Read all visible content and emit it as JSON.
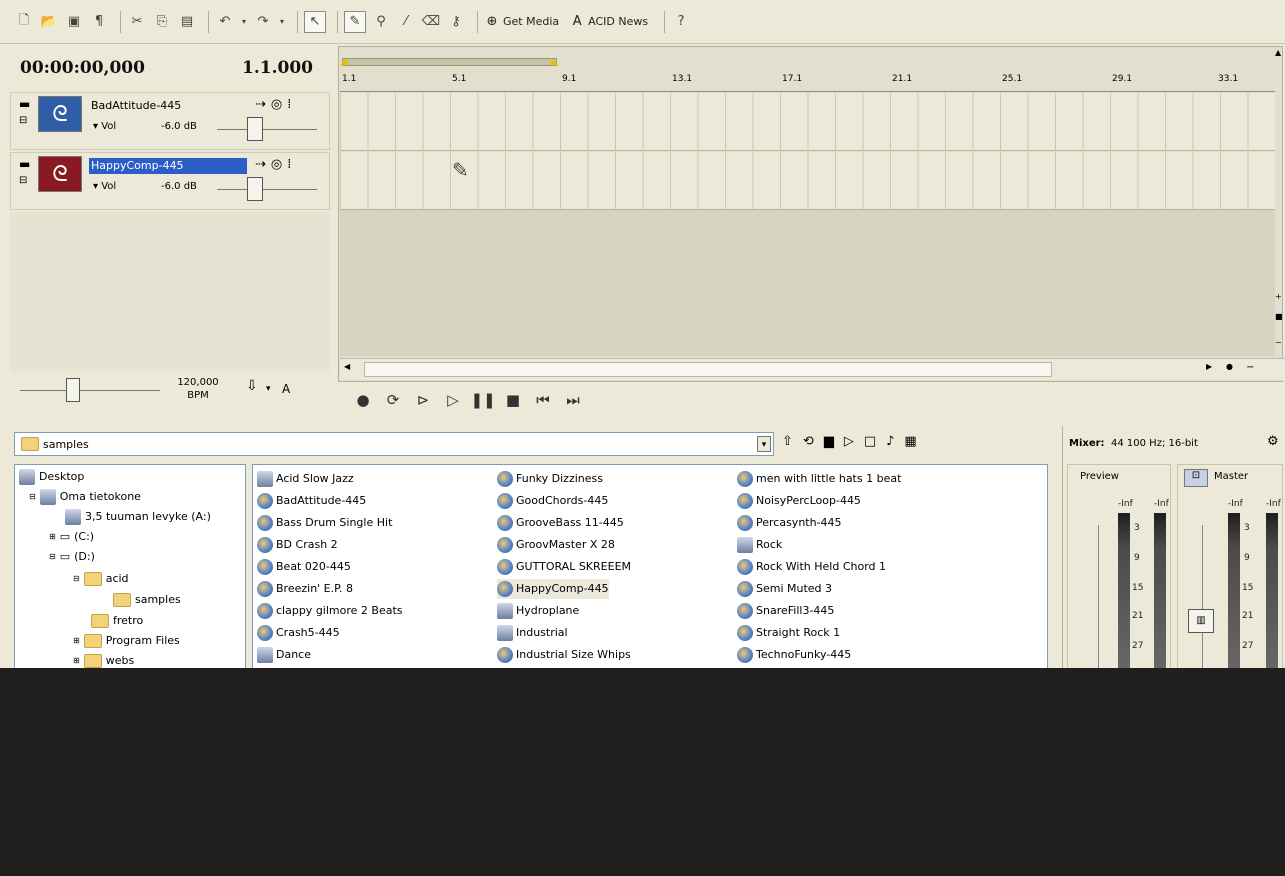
{
  "toolbar": {
    "buttons": [
      {
        "name": "new-icon",
        "glyph": "🗋"
      },
      {
        "name": "open-icon",
        "glyph": "📂"
      },
      {
        "name": "save-icon",
        "glyph": "💾"
      },
      {
        "name": "properties-icon",
        "glyph": "¶"
      },
      {
        "name": "cut-icon",
        "glyph": "✂"
      },
      {
        "name": "copy-icon",
        "glyph": "⎘"
      },
      {
        "name": "paste-icon",
        "glyph": "📋"
      },
      {
        "name": "undo-icon",
        "glyph": "↶"
      },
      {
        "name": "redo-icon",
        "glyph": "↷"
      }
    ],
    "get_media_label": "Get Media",
    "acid_news_label": "ACID News"
  },
  "timecode": "00:00:00,000",
  "measure": "1.1.000",
  "tracks": [
    {
      "name": "BadAttitude-445",
      "vol_label": "Vol",
      "db": "-6.0 dB",
      "color": "#2f5da6",
      "selected": false
    },
    {
      "name": "HappyComp-445",
      "vol_label": "Vol",
      "db": "-6.0 dB",
      "color": "#8a1a22",
      "selected": true
    }
  ],
  "ruler_ticks": [
    "1.1",
    "5.1",
    "9.1",
    "13.1",
    "17.1",
    "21.1",
    "25.1",
    "29.1",
    "33.1"
  ],
  "tempo": {
    "value": "120,000",
    "unit": "BPM",
    "key": "A"
  },
  "explorer": {
    "path": "samples",
    "tree": [
      {
        "label": "Desktop",
        "indent": 0
      },
      {
        "label": "Oma tietokone",
        "indent": 1
      },
      {
        "label": "3,5 tuuman levyke (A:)",
        "indent": 2
      },
      {
        "label": "(C:)",
        "indent": 2
      },
      {
        "label": "(D:)",
        "indent": 2
      },
      {
        "label": "acid",
        "indent": 3
      },
      {
        "label": "samples",
        "indent": 4
      },
      {
        "label": "fretro",
        "indent": 3
      },
      {
        "label": "Program Files",
        "indent": 3
      },
      {
        "label": "webs",
        "indent": 3
      }
    ],
    "files_col1": [
      "Acid Slow Jazz",
      "BadAttitude-445",
      "Bass Drum Single Hit",
      "BD Crash 2",
      "Beat 020-445",
      "Breezin' E.P. 8",
      "clappy gilmore 2 Beats",
      "Crash5-445",
      "Dance"
    ],
    "files_col2": [
      "Funky Dizziness",
      "GoodChords-445",
      "GrooveBass 11-445",
      "GroovMaster X 28",
      "GUTTORAL SKREEEM",
      "HappyComp-445",
      "Hydroplane",
      "Industrial",
      "Industrial Size Whips"
    ],
    "files_col3": [
      "men with little hats 1 beat",
      "NoisyPercLoop-445",
      "Percasynth-445",
      "Rock",
      "Rock With Held Chord 1",
      "Semi Muted 3",
      "SnareFill3-445",
      "Straight Rock 1",
      "TechnoFunky-445"
    ]
  },
  "mixer": {
    "title": "Mixer:",
    "format": "44 100 Hz; 16-bit",
    "preview_label": "Preview",
    "master_label": "Master",
    "scale": [
      "-Inf",
      "3",
      "9",
      "15",
      "21",
      "27"
    ]
  }
}
